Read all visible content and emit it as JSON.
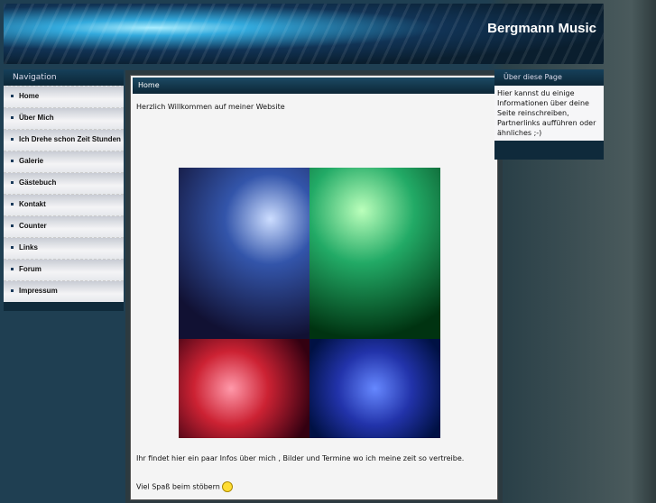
{
  "site_title": "Bergmann Music",
  "nav": {
    "heading": "Navigation",
    "items": [
      "Home",
      "Über Mich",
      "Ich Drehe schon Zeit Stunden",
      "Galerie",
      "Gästebuch",
      "Kontakt",
      "Counter",
      "Links",
      "Forum",
      "Impressum"
    ]
  },
  "main": {
    "heading": "Home",
    "welcome": "Herzlich Willkommen auf meiner Website",
    "info": "Ihr findet hier ein paar Infos über mich , Bilder und Termine wo ich meine zeit so vertreibe.",
    "closing": "Viel Spaß beim stöbern"
  },
  "side": {
    "heading": "Über diese Page",
    "text": "Hier kannst du einige Informationen über deine Seite reinschreiben, Partnerlinks aufführen oder ähnliches ;-)"
  }
}
